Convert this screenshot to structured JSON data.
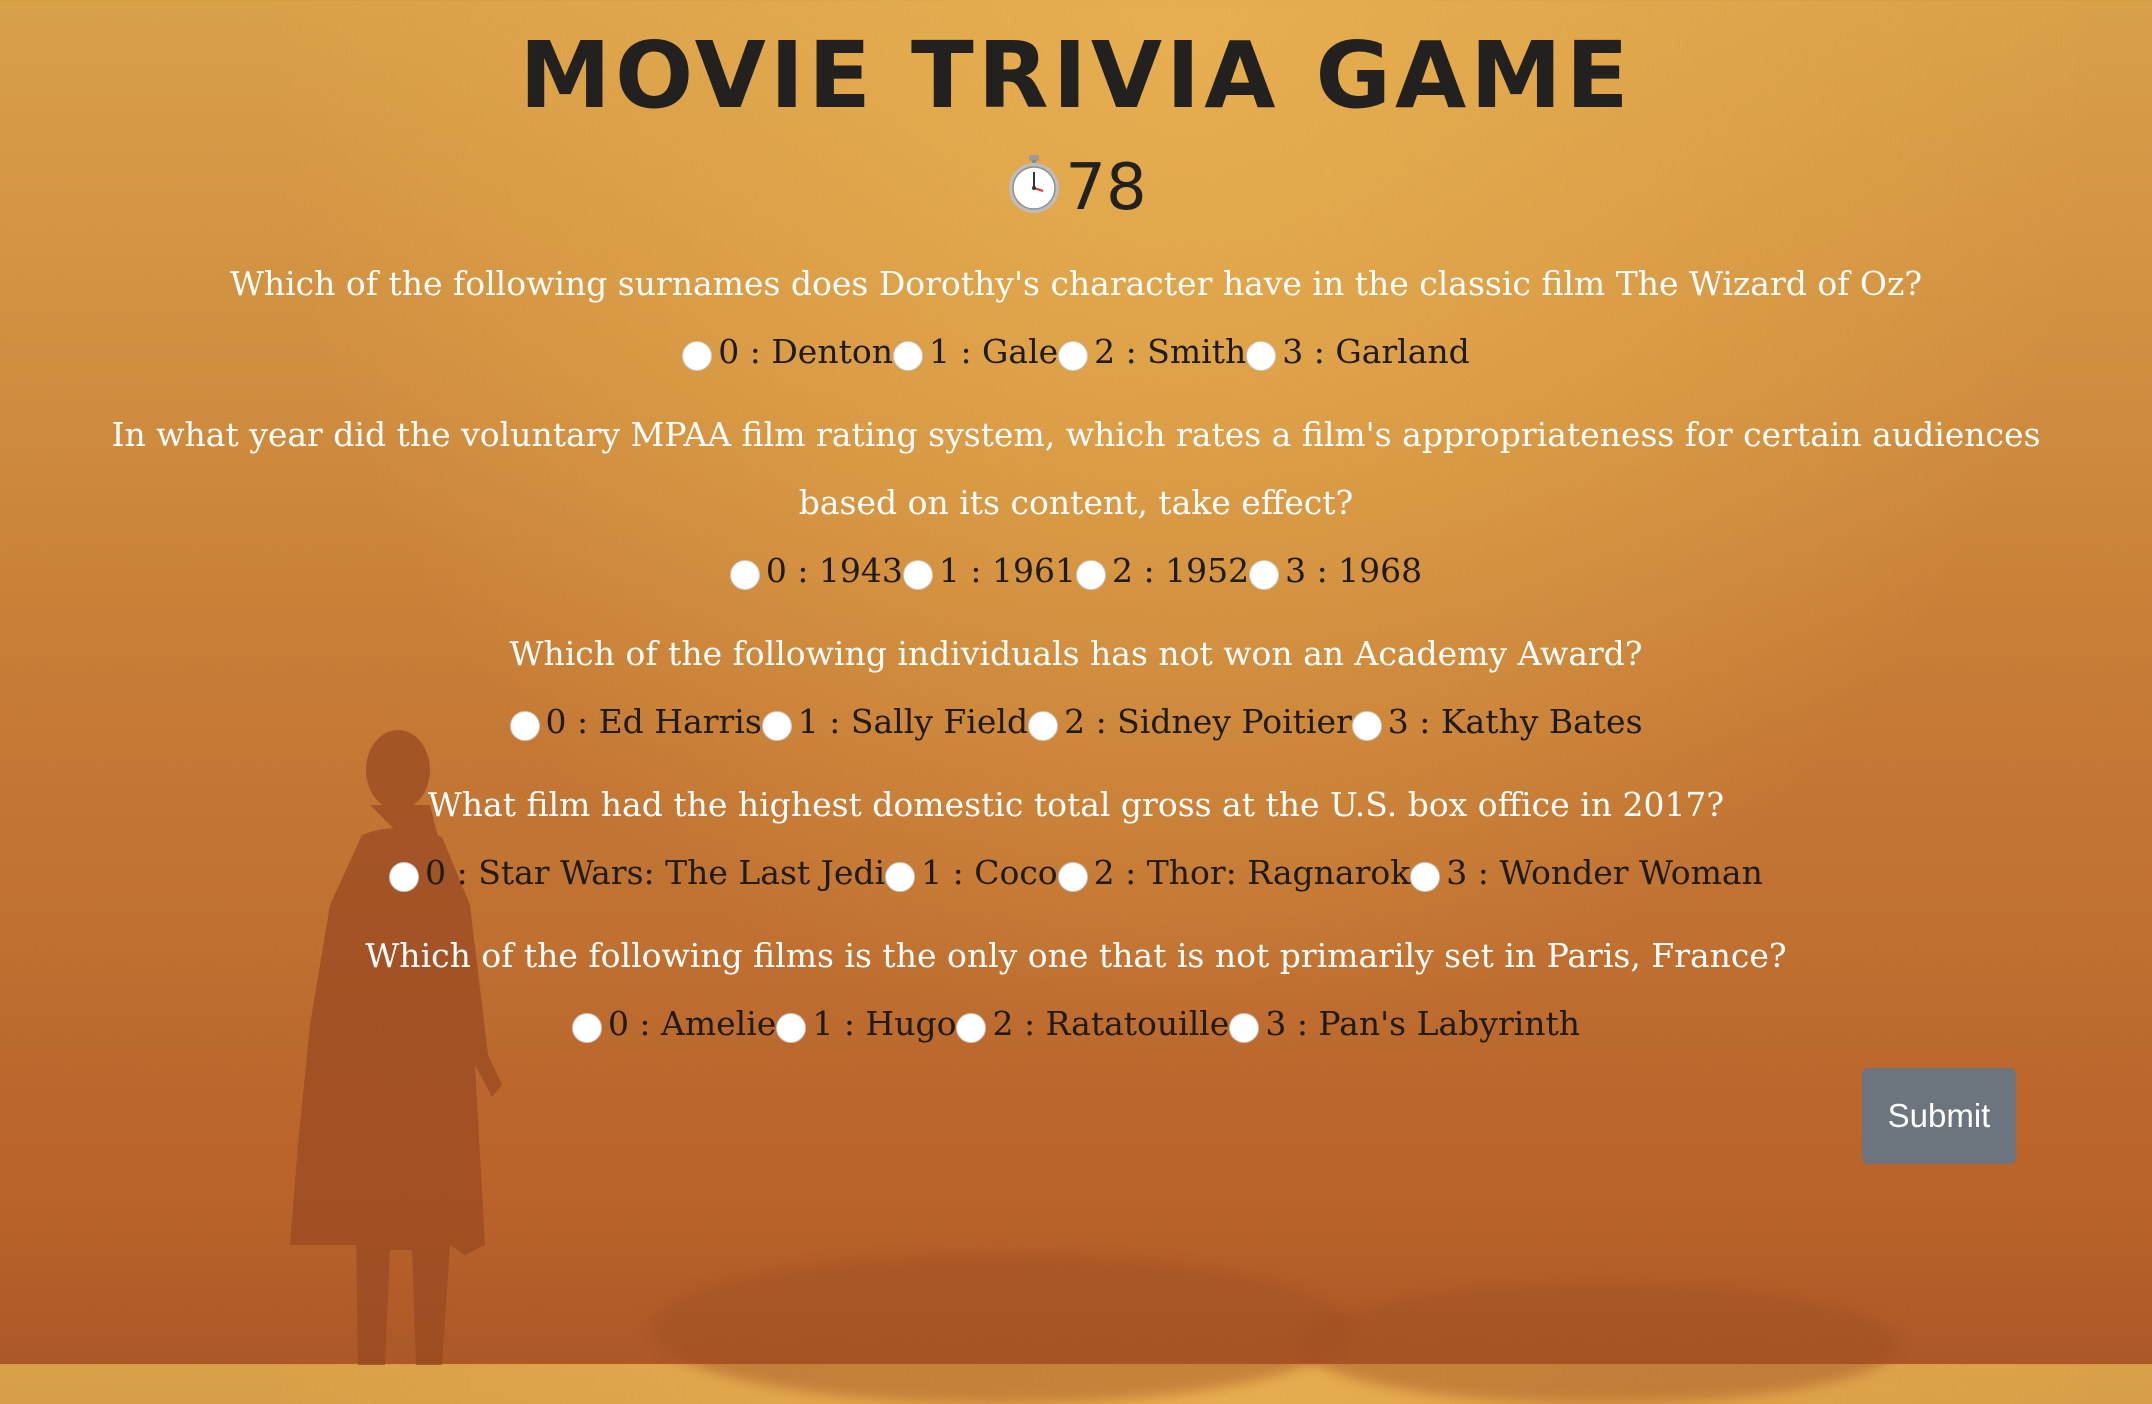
{
  "title": "MOVIE TRIVIA GAME",
  "timer": {
    "icon": "stopwatch-icon",
    "value": "78"
  },
  "questions": [
    {
      "text": "Which of the following surnames does Dorothy's character have in the classic film The Wizard of Oz?",
      "options": [
        "0 : Denton",
        "1 : Gale",
        "2 : Smith",
        "3 : Garland"
      ]
    },
    {
      "text": "In what year did the voluntary MPAA film rating system, which rates a film's appropriateness for certain audiences based on its content, take effect?",
      "options": [
        "0 : 1943",
        "1 : 1961",
        "2 : 1952",
        "3 : 1968"
      ]
    },
    {
      "text": "Which of the following individuals has not won an Academy Award?",
      "options": [
        "0 : Ed Harris",
        "1 : Sally Field",
        "2 : Sidney Poitier",
        "3 : Kathy Bates"
      ]
    },
    {
      "text": "What film had the highest domestic total gross at the U.S. box office in 2017?",
      "options": [
        "0 : Star Wars: The Last Jedi",
        "1 : Coco",
        "2 : Thor: Ragnarok",
        "3 : Wonder Woman"
      ]
    },
    {
      "text": "Which of the following films is the only one that is not primarily set in Paris, France?",
      "options": [
        "0 : Amelie",
        "1 : Hugo",
        "2 : Ratatouille",
        "3 : Pan's Labyrinth"
      ]
    }
  ],
  "submit_label": "Submit",
  "colors": {
    "button_bg": "#6c757d",
    "title": "#23211f",
    "question_text": "#ffffff",
    "option_text": "#1e1a16"
  }
}
